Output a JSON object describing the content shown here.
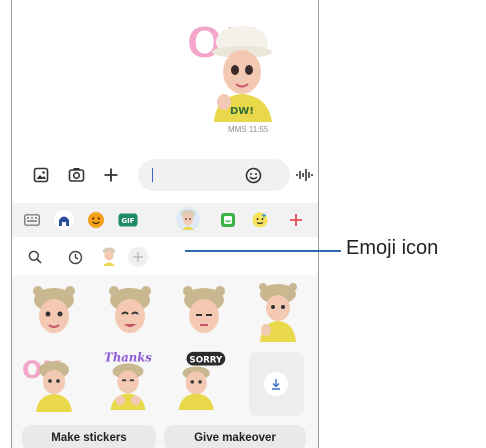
{
  "message": {
    "time": "MMS 11:55",
    "sticker_text": "OK",
    "shirt_text": "DW!"
  },
  "input": {
    "placeholder": ""
  },
  "keyboard_toolbar": {
    "items": [
      "keyboard-icon",
      "home-icon",
      "emoji-icon",
      "gif-icon",
      "ar-emoji-icon",
      "sticker-icon",
      "bitmoji-icon",
      "plus-icon"
    ],
    "gif_label": "GIF",
    "accent": "#e03a3a"
  },
  "sticker_tabs": [
    "search-icon",
    "recent-icon",
    "ar-emoji-tab",
    "add-icon"
  ],
  "stickers": [
    {
      "caption": ""
    },
    {
      "caption": ""
    },
    {
      "caption": ""
    },
    {
      "caption": ""
    },
    {
      "caption": "OK"
    },
    {
      "caption": "Thanks"
    },
    {
      "caption": "SORRY"
    },
    {
      "caption": ""
    }
  ],
  "buttons": {
    "make_stickers": "Make stickers",
    "give_makeover": "Give makeover"
  },
  "callout": {
    "label": "Emoji icon"
  }
}
